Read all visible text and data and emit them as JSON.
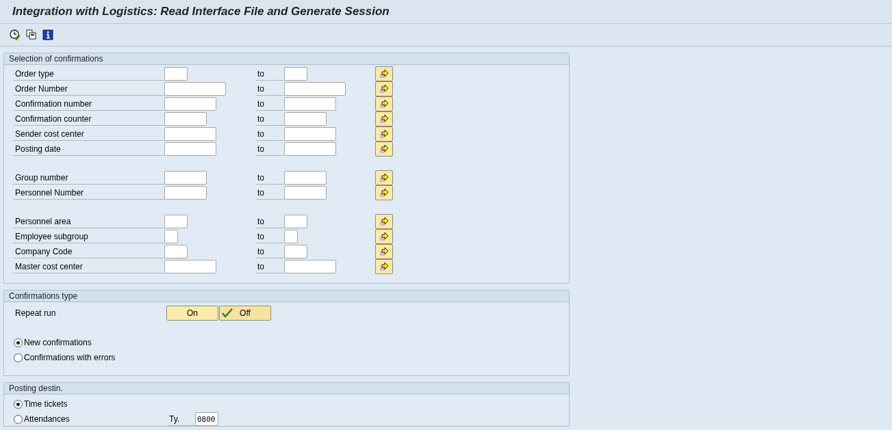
{
  "window": {
    "title": "Integration with Logistics: Read Interface File and Generate Session"
  },
  "toolbar": {
    "buttons": [
      {
        "kind": "execute"
      },
      {
        "kind": "variants"
      },
      {
        "kind": "info"
      }
    ]
  },
  "selection": {
    "title": "Selection of confirmations",
    "groups": [
      [
        {
          "label": "Order type",
          "to": "to"
        },
        {
          "label": "Order Number",
          "to": "to"
        },
        {
          "label": "Confirmation number",
          "to": "to"
        },
        {
          "label": "Confirmation counter",
          "to": "to"
        },
        {
          "label": "Sender cost center",
          "to": "to"
        },
        {
          "label": "Posting date",
          "to": "to"
        }
      ],
      [
        {
          "label": "Group number",
          "to": "to"
        },
        {
          "label": "Personnel Number",
          "to": "to"
        }
      ],
      [
        {
          "label": "Personnel area",
          "to": "to"
        },
        {
          "label": "Employee subgroup",
          "to": "to"
        },
        {
          "label": "Company Code",
          "to": "to"
        },
        {
          "label": "Master cost center",
          "to": "to"
        }
      ]
    ]
  },
  "confirmations_type": {
    "title": "Confirmations type",
    "repeat_run": {
      "label": "Repeat run",
      "options": [
        {
          "label": "On",
          "selected": false
        },
        {
          "label": "Off",
          "selected": true
        }
      ]
    },
    "radios": [
      {
        "label": "New confirmations",
        "selected": true
      },
      {
        "label": "Confirmations with errors",
        "selected": false
      }
    ]
  },
  "posting_destin": {
    "title": "Posting destin.",
    "radios": [
      {
        "label": "Time tickets",
        "selected": true
      },
      {
        "label": "Attendances",
        "selected": false
      }
    ],
    "type_field": {
      "label": "Ty.",
      "value": "0800"
    }
  }
}
